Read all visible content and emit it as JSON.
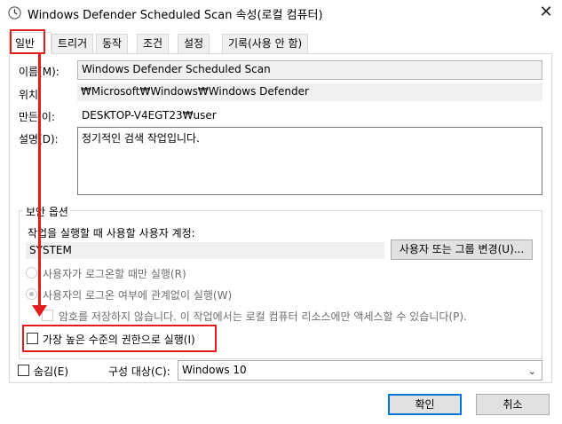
{
  "window": {
    "title": "Windows Defender Scheduled Scan 속성(로컬 컴퓨터)",
    "close_glyph": "✕",
    "icon": "clock-icon"
  },
  "tabs": [
    "일반",
    "트리거",
    "동작",
    "조건",
    "설정",
    "기록(사용 안 함)"
  ],
  "active_tab": "일반",
  "general": {
    "name_label": "이름(M):",
    "name_value": "Windows Defender Scheduled Scan",
    "location_label": "위치:",
    "location_value": "₩Microsoft₩Windows₩Windows Defender",
    "author_label": "만든 이:",
    "author_value": "DESKTOP-V4EGT23₩user",
    "description_label": "설명(D):",
    "description_value": "정기적인 검색 작업입니다."
  },
  "security": {
    "legend": "보안 옵션",
    "account_prompt": "작업을 실행할 때 사용할 사용자 계정:",
    "account_value": "SYSTEM",
    "change_user_button": "사용자 또는 그룹 변경(U)...",
    "radio_logged_on": "사용자가 로그온할 때만 실행(R)",
    "radio_whether": "사용자의 로그온 여부에 관계없이 실행(W)",
    "radio_whether_checked": true,
    "no_store_password": "암호를 저장하지 않습니다. 이 작업에서는 로컬 컴퓨터 리소스에만 액세스할 수 있습니다(P).",
    "highest_privileges": "가장 높은 수준의 권한으로 실행(I)"
  },
  "footer": {
    "hidden_label": "숨김(E)",
    "configure_label": "구성 대상(C):",
    "configure_value": "Windows 10",
    "ok_button": "확인",
    "cancel_button": "취소"
  },
  "annotation": {
    "color": "#e21d1d"
  }
}
